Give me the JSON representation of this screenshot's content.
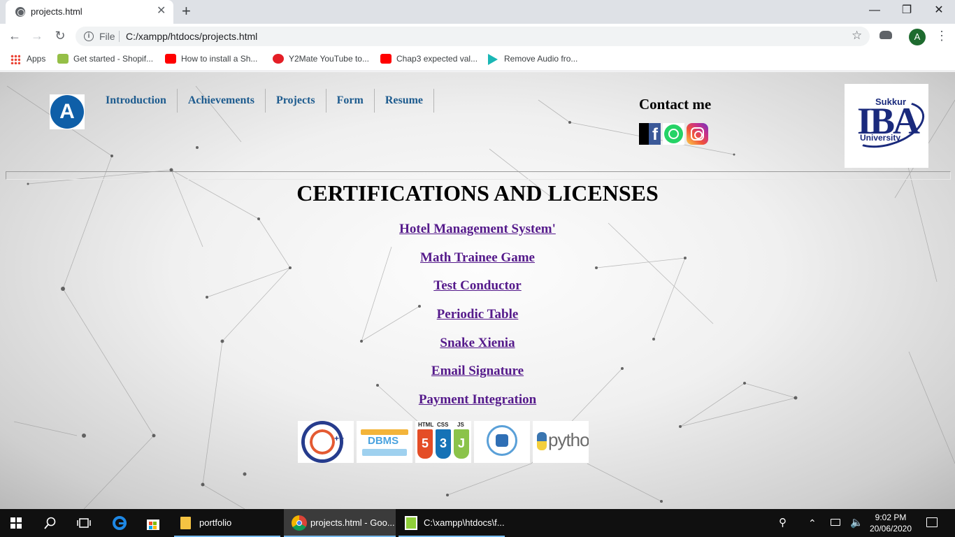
{
  "browser": {
    "tab_title": "projects.html",
    "tab_close": "✕",
    "new_tab": "+",
    "window_controls": {
      "minimize": "—",
      "restore": "❐",
      "close": "✕"
    },
    "nav": {
      "back": "←",
      "forward": "→",
      "reload": "↻",
      "more": "⋮"
    },
    "address": {
      "info": "i",
      "scheme": "File",
      "url": "C:/xampp/htdocs/projects.html",
      "star": "☆"
    },
    "profile_initial": "A",
    "bookmarks": [
      {
        "label": "Apps",
        "icon": "apps-grid-icon"
      },
      {
        "label": "Get started - Shopif...",
        "icon": "shopify-icon",
        "color": "#95bf47"
      },
      {
        "label": "How to install a Sh...",
        "icon": "youtube-icon",
        "color": "#ff0000"
      },
      {
        "label": "Y2Mate YouTube to...",
        "icon": "download-icon",
        "color": "#e41e26"
      },
      {
        "label": "Chap3 expected val...",
        "icon": "youtube-icon",
        "color": "#ff0000"
      },
      {
        "label": "Remove Audio fro...",
        "icon": "play-icon",
        "color": "#1ab7b5"
      }
    ]
  },
  "site": {
    "logo_letter": "A",
    "nav": [
      "Introduction",
      "Achievements",
      "Projects",
      "Form",
      "Resume"
    ],
    "contact_title": "Contact me",
    "social": {
      "facebook": "f"
    },
    "university_logo": {
      "top": "Sukkur",
      "main": "IBA",
      "bottom": "University"
    },
    "heading": "CERTIFICATIONS AND LICENSES",
    "projects": [
      "Hotel Management System'",
      "Math Trainee Game",
      "Test Conductor",
      "Periodic Table",
      "Snake Xienia",
      "Email Signature",
      "Payment Integration"
    ],
    "tech_logos": {
      "cpp": "++",
      "dbms": "DBMS",
      "web": {
        "html": "HTML",
        "css": "CSS",
        "js": "JS",
        "html_n": "5",
        "css_n": "3",
        "js_n": "J"
      },
      "python": "python"
    },
    "link_color": "#551a8b",
    "nav_color": "#1d5b8e"
  },
  "taskbar": {
    "tasks": [
      {
        "label": "portfolio",
        "icon": "folder-icon"
      },
      {
        "label": "projects.html - Goo...",
        "icon": "chrome-icon"
      },
      {
        "label": "C:\\xampp\\htdocs\\f...",
        "icon": "notepad-icon"
      }
    ],
    "time": "9:02 PM",
    "date": "20/06/2020"
  }
}
